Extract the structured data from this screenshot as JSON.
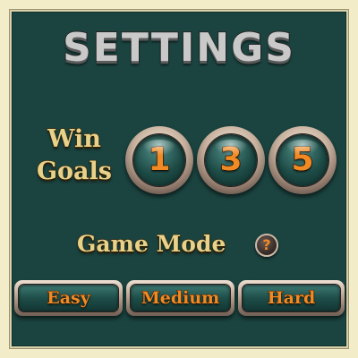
{
  "title": "SETTINGS",
  "win_goals": {
    "label_line1": "Win",
    "label_line2": "Goals",
    "options": [
      "1",
      "3",
      "5"
    ]
  },
  "game_mode": {
    "label": "Game Mode",
    "help_symbol": "?",
    "options": [
      "Easy",
      "Medium",
      "Hard"
    ]
  },
  "colors": {
    "panel_background": "#1b4440",
    "frame_background": "#f3ecc8",
    "label_gold": "#e8d28a",
    "button_text_orange": "#f08a24",
    "title_silver": "#c9c9c9"
  }
}
